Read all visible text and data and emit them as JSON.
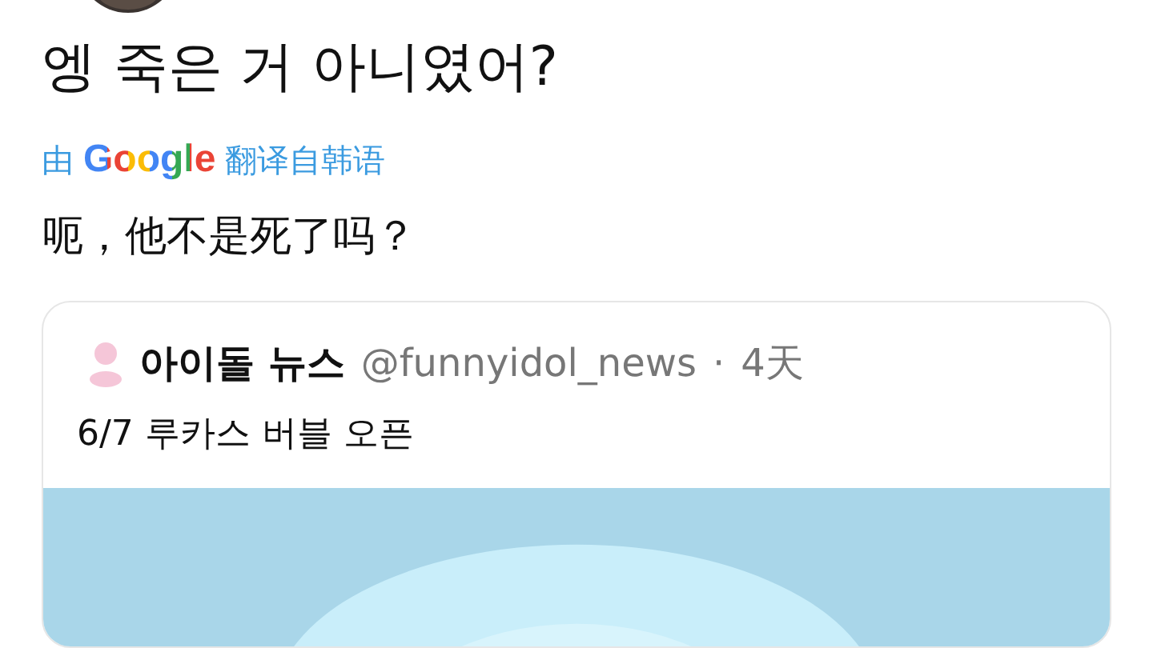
{
  "tweet": {
    "text": "엥 죽은 거 아니였어?",
    "translation": {
      "prefix": "由",
      "provider": "Google",
      "suffix": "翻译自韩语"
    },
    "translated_text": "呃，他不是死了吗？"
  },
  "quoted_tweet": {
    "name": "아이돌 뉴스",
    "handle": "@funnyidol_news",
    "separator": "·",
    "time": "4天",
    "text": "6/7 루카스 버블 오픈"
  }
}
